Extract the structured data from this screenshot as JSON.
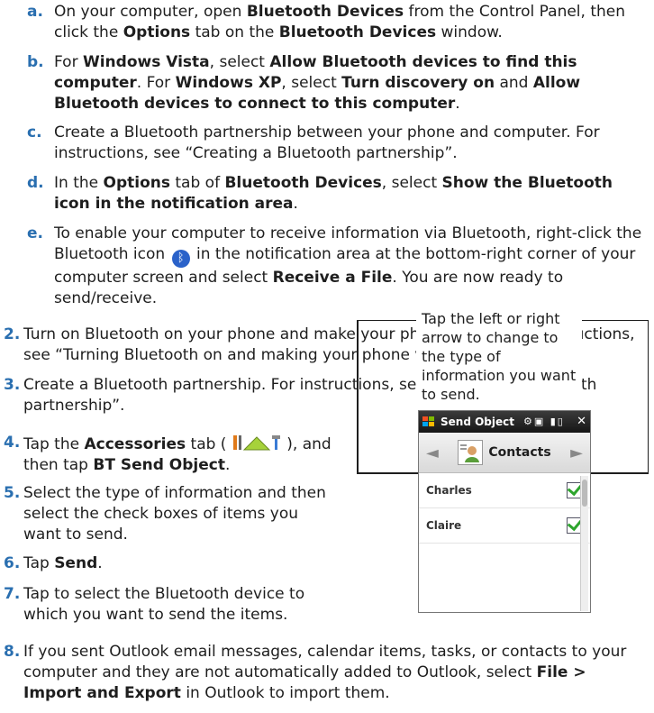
{
  "steps_sub": [
    {
      "num": "a.",
      "parts": [
        {
          "t": "On your computer, open "
        },
        {
          "b": "Bluetooth Devices"
        },
        {
          "t": " from the Control Panel, then click the "
        },
        {
          "b": "Options"
        },
        {
          "t": " tab on the "
        },
        {
          "b": "Bluetooth Devices"
        },
        {
          "t": " window."
        }
      ]
    },
    {
      "num": "b.",
      "parts": [
        {
          "t": "For "
        },
        {
          "b": "Windows Vista"
        },
        {
          "t": ", select "
        },
        {
          "b": "Allow Bluetooth devices to find this computer"
        },
        {
          "t": ". For "
        },
        {
          "b": "Windows XP"
        },
        {
          "t": ", select "
        },
        {
          "b": "Turn discovery on"
        },
        {
          "t": " and "
        },
        {
          "b": "Allow Bluetooth devices to connect to this computer"
        },
        {
          "t": "."
        }
      ]
    },
    {
      "num": "c.",
      "parts": [
        {
          "t": "Create a Bluetooth partnership between your phone and computer. For instructions, see “Creating a Bluetooth partnership”."
        }
      ]
    },
    {
      "num": "d.",
      "parts": [
        {
          "t": "In the "
        },
        {
          "b": "Options"
        },
        {
          "t": " tab of "
        },
        {
          "b": "Bluetooth Devices"
        },
        {
          "t": ", select "
        },
        {
          "b": "Show the Bluetooth icon in the notification area"
        },
        {
          "t": "."
        }
      ]
    },
    {
      "num": "e.",
      "parts": [
        {
          "t": "To enable your computer to receive information via Bluetooth, right-click the Bluetooth icon "
        },
        {
          "icon": "bluetooth-icon"
        },
        {
          "t": " in the notification area at the bottom-right corner of your computer screen and select "
        },
        {
          "b": "Receive a File"
        },
        {
          "t": ". You are now ready to send/receive."
        }
      ]
    }
  ],
  "steps_main": [
    {
      "num": "2.",
      "parts": [
        {
          "t": "Turn on Bluetooth on your phone and make your phone visible. For instructions, see “Turning Bluetooth on and making your phone visible”."
        }
      ]
    },
    {
      "num": "3.",
      "parts": [
        {
          "t": "Create a Bluetooth partnership. For instructions, see “Creating a Bluetooth partnership”."
        }
      ]
    },
    {
      "num": "4.",
      "parts": [
        {
          "t": "Tap the "
        },
        {
          "b": "Accessories"
        },
        {
          "t": " tab ( "
        },
        {
          "icon": "accessories-icon"
        },
        {
          "t": " ), and then tap "
        },
        {
          "b": "BT Send Object"
        },
        {
          "t": "."
        }
      ]
    },
    {
      "num": "5.",
      "parts": [
        {
          "t": "Select the type of information and then select the check boxes of items you want to send."
        }
      ]
    },
    {
      "num": "6.",
      "parts": [
        {
          "t": "Tap "
        },
        {
          "b": "Send"
        },
        {
          "t": "."
        }
      ]
    },
    {
      "num": "7.",
      "parts": [
        {
          "t": "Tap to select the Bluetooth device to which you want to send the items."
        }
      ]
    },
    {
      "num": "8.",
      "parts": [
        {
          "t": "If you sent Outlook email messages, calendar items, tasks, or contacts to your computer and they are not automatically added to Outlook, select "
        },
        {
          "b": "File > Import and Export"
        },
        {
          "t": " in Outlook to import them."
        }
      ]
    }
  ],
  "callout": "Tap the left or right arrow to change to the type of information you want to send.",
  "phone": {
    "title": "Send Object",
    "status_icons": "⚙▣ ▮▯",
    "tab_label": "Contacts",
    "left_arrow": "◄",
    "right_arrow": "►",
    "close": "✕",
    "rows": [
      "Charles",
      "Claire"
    ]
  },
  "colors": {
    "step_number": "#2a6fb0",
    "marker": "#2a62c9"
  }
}
